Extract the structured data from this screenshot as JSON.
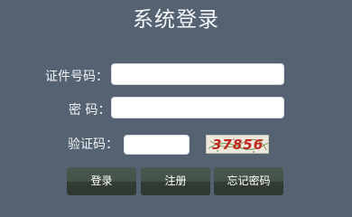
{
  "page": {
    "title": "系统登录"
  },
  "form": {
    "id_label": "证件号码：",
    "password_label": "密 码：",
    "captcha_label": "验证码：",
    "id_value": "",
    "password_value": "",
    "captcha_value": ""
  },
  "captcha": {
    "text": "37856"
  },
  "buttons": {
    "login": "登录",
    "register": "注册",
    "forgot": "忘记密码"
  }
}
